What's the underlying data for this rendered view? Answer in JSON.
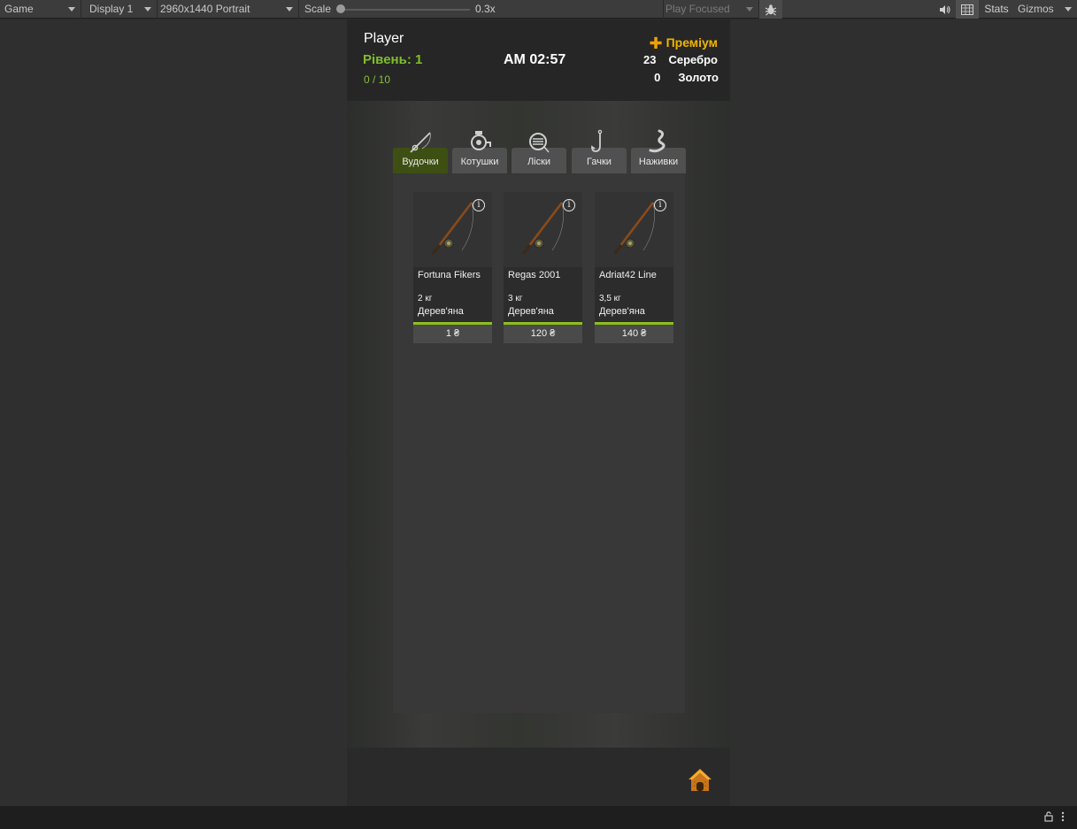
{
  "toolbar": {
    "view_mode": "Game",
    "display": "Display 1",
    "resolution": "2960x1440 Portrait",
    "scale_label": "Scale",
    "scale_value": "0.3x",
    "play_mode": "Play Focused",
    "stats_label": "Stats",
    "gizmos_label": "Gizmos",
    "icons": [
      "bug-icon",
      "speaker-icon",
      "grid-icon"
    ]
  },
  "header": {
    "player_name": "Player",
    "level": "Рівень: 1",
    "xp": "0 / 10",
    "clock": "AM 02:57",
    "premium": "Преміум",
    "silver_amount": "23",
    "silver_label": "Серебро",
    "gold_amount": "0",
    "gold_label": "Золото"
  },
  "tabs": [
    {
      "label": "Вудочки",
      "icon": "rod-icon",
      "active": true
    },
    {
      "label": "Котушки",
      "icon": "reel-icon",
      "active": false
    },
    {
      "label": "Ліски",
      "icon": "line-icon",
      "active": false
    },
    {
      "label": "Гачки",
      "icon": "hook-icon",
      "active": false
    },
    {
      "label": "Наживки",
      "icon": "worm-icon",
      "active": false
    }
  ],
  "items": [
    {
      "name": "Fortuna Fikers",
      "weight": "2 кг",
      "material": "Дерев'яна",
      "price": "1 ₴"
    },
    {
      "name": "Regas 2001",
      "weight": "3 кг",
      "material": "Дерев'яна",
      "price": "120 ₴"
    },
    {
      "name": "Adriat42 Line",
      "weight": "3,5 кг",
      "material": "Дерев'яна",
      "price": "140 ₴"
    }
  ],
  "colors": {
    "accent_green": "#7fbf2a",
    "premium_gold": "#f0b400",
    "active_tab": "#3d4f12",
    "price_bar": "#8dbf1f"
  }
}
